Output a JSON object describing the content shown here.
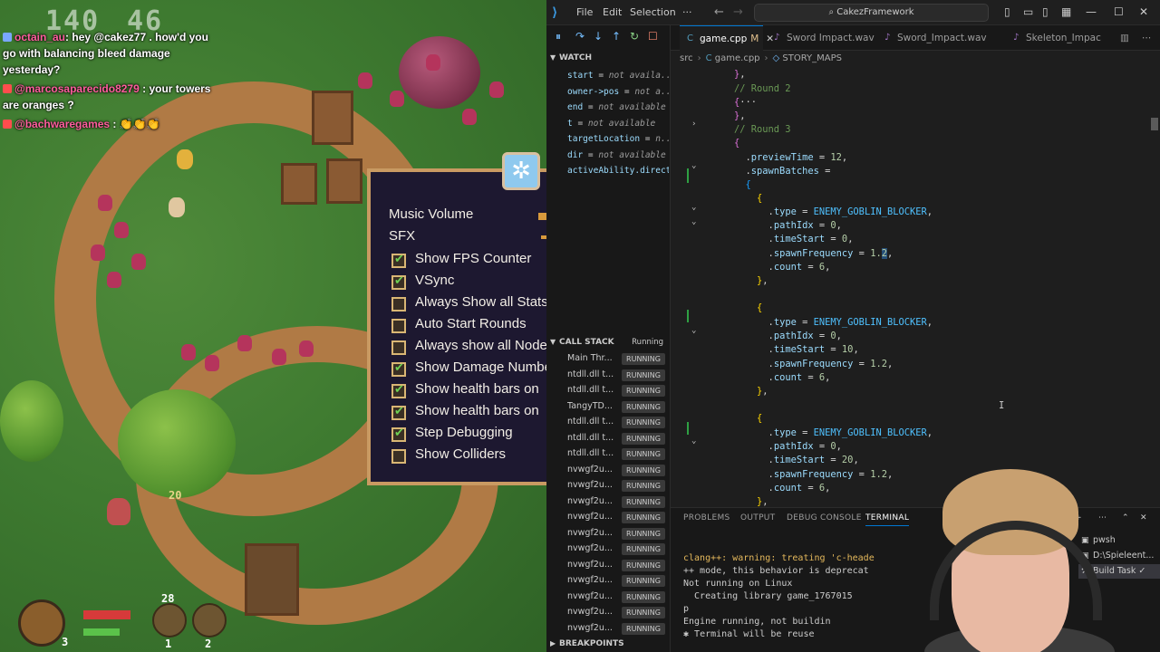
{
  "game": {
    "hud": {
      "lives": "140",
      "gold": "46"
    },
    "chat": [
      {
        "user": "octain_au",
        "text": "hey @cakez77 . how'd you go with balancing bleed damage yesterday?"
      },
      {
        "user": "@marcosaparecido8279",
        "text": "your towers are oranges ?"
      },
      {
        "user": "@bachwaregames",
        "text": "👏👏👏"
      }
    ],
    "settings": {
      "music_label": "Music Volume",
      "sfx_label": "SFX",
      "options": [
        {
          "label": "Show FPS Counter",
          "checked": true
        },
        {
          "label": "VSync",
          "checked": true
        },
        {
          "label": "Always Show all Stats",
          "checked": false
        },
        {
          "label": "Auto Start Rounds",
          "checked": false
        },
        {
          "label": "Always show all Node",
          "checked": false
        },
        {
          "label": "Show Damage Number",
          "checked": true
        },
        {
          "label": "Show health bars on",
          "checked": true
        },
        {
          "label": "Show health bars on",
          "checked": true
        },
        {
          "label": "Step Debugging",
          "checked": true
        },
        {
          "label": "Show Colliders",
          "checked": false
        }
      ]
    },
    "bottom_hud": {
      "count_a": "3",
      "count_b": "28",
      "count_c": "1",
      "count_d": "2",
      "marker": "20"
    }
  },
  "vscode": {
    "menus": [
      "File",
      "Edit",
      "Selection",
      "···"
    ],
    "search": "CakezFramework",
    "debug_toolbar": [
      "pause",
      "step-over",
      "step-into",
      "step-out",
      "restart",
      "stop"
    ],
    "watch": {
      "title": "WATCH",
      "items": [
        {
          "name": "start",
          "value": "not availa..."
        },
        {
          "name": "owner->pos",
          "value": "not a..."
        },
        {
          "name": "end",
          "value": "not available"
        },
        {
          "name": "t",
          "value": "not available"
        },
        {
          "name": "targetLocation",
          "value": "n..."
        },
        {
          "name": "dir",
          "value": "not available"
        },
        {
          "name": "activeAbility.direct",
          "value": ""
        }
      ]
    },
    "call_stack": {
      "title": "CALL STACK",
      "status": "Running",
      "items": [
        {
          "name": "Main Thr...",
          "tag": "RUNNING"
        },
        {
          "name": "ntdll.dll t...",
          "tag": "RUNNING"
        },
        {
          "name": "ntdll.dll t...",
          "tag": "RUNNING"
        },
        {
          "name": "TangyTD...",
          "tag": "RUNNING"
        },
        {
          "name": "ntdll.dll t...",
          "tag": "RUNNING"
        },
        {
          "name": "ntdll.dll t...",
          "tag": "RUNNING"
        },
        {
          "name": "ntdll.dll t...",
          "tag": "RUNNING"
        },
        {
          "name": "nvwgf2u...",
          "tag": "RUNNING"
        },
        {
          "name": "nvwgf2u...",
          "tag": "RUNNING"
        },
        {
          "name": "nvwgf2u...",
          "tag": "RUNNING"
        },
        {
          "name": "nvwgf2u...",
          "tag": "RUNNING"
        },
        {
          "name": "nvwgf2u...",
          "tag": "RUNNING"
        },
        {
          "name": "nvwgf2u...",
          "tag": "RUNNING"
        },
        {
          "name": "nvwgf2u...",
          "tag": "RUNNING"
        },
        {
          "name": "nvwgf2u...",
          "tag": "RUNNING"
        },
        {
          "name": "nvwgf2u...",
          "tag": "RUNNING"
        },
        {
          "name": "nvwgf2u...",
          "tag": "RUNNING"
        },
        {
          "name": "nvwgf2u...",
          "tag": "RUNNING"
        }
      ]
    },
    "breakpoints_title": "BREAKPOINTS",
    "tabs": [
      {
        "label": "game.cpp",
        "modified": "M",
        "active": true
      },
      {
        "label": "Sword Impact.wav",
        "active": false
      },
      {
        "label": "Sword_Impact.wav",
        "active": false
      },
      {
        "label": "Skeleton_Impac",
        "active": false
      }
    ],
    "breadcrumb": [
      "src",
      "game.cpp",
      "STORY_MAPS"
    ],
    "panel_tabs": [
      "PROBLEMS",
      "OUTPUT",
      "DEBUG CONSOLE",
      "TERMINAL"
    ],
    "terminal_lines": [
      "clang++: warning: treating 'c-heade",
      "++ mode, this behavior is deprecat",
      "Not running on Linux",
      "  Creating library game_1767015",
      "p",
      "Engine running, not buildin",
      "Terminal will be reuse"
    ],
    "terminal_list": [
      {
        "label": "pwsh",
        "selected": false
      },
      {
        "label": "D:\\Spieleent...",
        "selected": false
      },
      {
        "label": "Build  Task",
        "selected": true
      }
    ]
  }
}
